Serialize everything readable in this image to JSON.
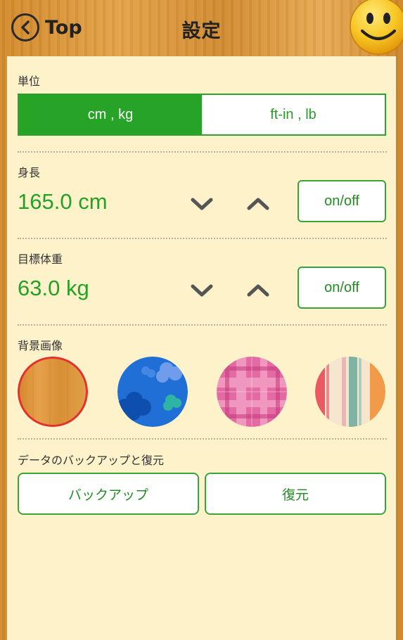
{
  "header": {
    "back_label": "Top",
    "title": "設定"
  },
  "units": {
    "label": "単位",
    "options": [
      "cm , kg",
      "ft-in , lb"
    ],
    "selected": "cm , kg"
  },
  "height": {
    "label": "身長",
    "value": "165.0 cm",
    "toggle_label": "on/off"
  },
  "target_weight": {
    "label": "目標体重",
    "value": "63.0 kg",
    "toggle_label": "on/off"
  },
  "background": {
    "label": "背景画像",
    "options": [
      "wood",
      "blue-floral",
      "pink-plaid",
      "stripes"
    ],
    "selected": "wood"
  },
  "backup": {
    "label": "データのバックアップと復元",
    "backup_label": "バックアップ",
    "restore_label": "復元"
  },
  "colors": {
    "accent": "#27a327",
    "panel": "#fdf2c9",
    "selected_ring": "#e53030"
  }
}
